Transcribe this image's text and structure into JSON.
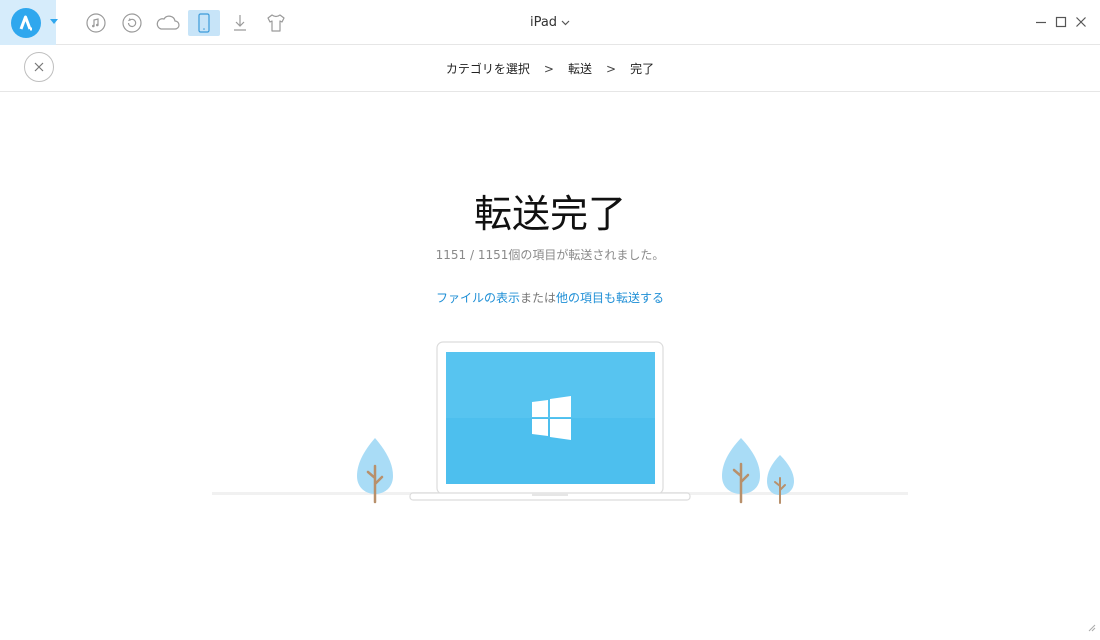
{
  "toolbar": {
    "icons": [
      "app-logo-icon",
      "music-icon",
      "restore-icon",
      "cloud-icon",
      "device-icon",
      "download-icon",
      "tshirt-icon"
    ],
    "active_icon": "device-icon",
    "accent_color": "#2fa7ee"
  },
  "header": {
    "device_name": "iPad",
    "window_controls": [
      "minimize-icon",
      "maximize-icon",
      "close-icon"
    ]
  },
  "steps": {
    "items": [
      "カテゴリを選択",
      "転送",
      "完了"
    ],
    "separator": ">"
  },
  "main": {
    "title": "転送完了",
    "summary": "1151 / 1151個の項目が転送されました。",
    "link_view_files": "ファイルの表示",
    "connector": "または",
    "link_transfer_more": "他の項目も転送する"
  },
  "illustration": {
    "screen_color": "#4dbfee",
    "tree_color": "#a9dcf6",
    "logo": "windows-logo-icon"
  }
}
